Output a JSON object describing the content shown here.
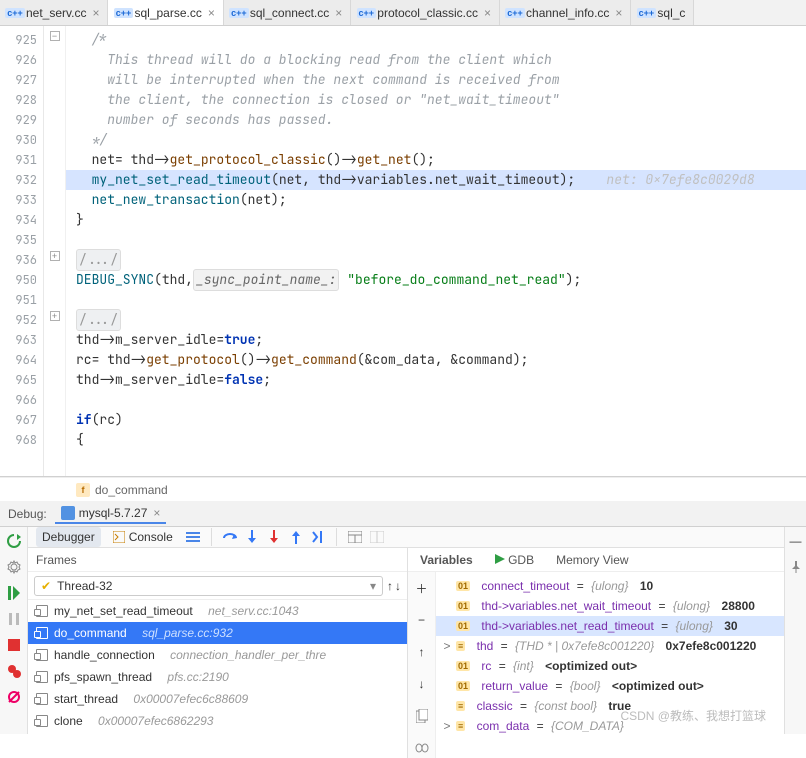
{
  "tabs": [
    {
      "label": "net_serv.cc",
      "icon": "c++",
      "active": false
    },
    {
      "label": "sql_parse.cc",
      "icon": "c++",
      "active": true
    },
    {
      "label": "sql_connect.cc",
      "icon": "c++",
      "active": false
    },
    {
      "label": "protocol_classic.cc",
      "icon": "c++",
      "active": false
    },
    {
      "label": "channel_info.cc",
      "icon": "c++",
      "active": false
    },
    {
      "label": "sql_c",
      "icon": "c++",
      "active": false
    }
  ],
  "gutter": [
    "925",
    "926",
    "927",
    "928",
    "929",
    "930",
    "931",
    "932",
    "933",
    "934",
    "935",
    "936",
    "950",
    "951",
    "952",
    "963",
    "964",
    "965",
    "966",
    "967",
    "968"
  ],
  "code": {
    "l925": "/*",
    "l926": "This thread will do a blocking read from the client which",
    "l927": "will be interrupted when the next command is received from",
    "l928": "the client, the connection is closed or \"net_wait_timeout\"",
    "l929": "number of seconds has passed.",
    "l930": "*/",
    "l931_pre": "net= thd->",
    "l931_m1": "get_protocol_classic",
    "l931_mid": "()->",
    "l931_m2": "get_net",
    "l931_post": "();",
    "l932_fn": "my_net_set_read_timeout",
    "l932_args": "(net, thd->variables.net_wait_timeout);",
    "l932_inlay": "net: 0x7efe8c0029d8",
    "l933_fn": "net_new_transaction",
    "l933_args": "(net);",
    "l934": "}",
    "l936": "/.../",
    "l950_fn": "DEBUG_SYNC",
    "l950_open": "(thd, ",
    "l950_param": "_sync_point_name_:",
    "l950_str": "\"before_do_command_net_read\"",
    "l950_close": ");",
    "l952": "/.../",
    "l963_pre": "thd->m_server_idle= ",
    "l963_kw": "true",
    "l963_post": ";",
    "l964_pre": "rc= thd->",
    "l964_m1": "get_protocol",
    "l964_mid": "()->",
    "l964_m2": "get_command",
    "l964_post": "(&com_data, &command);",
    "l965_pre": "thd->m_server_idle= ",
    "l965_kw": "false",
    "l965_post": ";",
    "l967_kw": "if",
    "l967_rest": " (rc)",
    "l968": "{"
  },
  "breadcrumb": {
    "icon": "f",
    "name": "do_command"
  },
  "debug": {
    "label": "Debug:",
    "config": "mysql-5.7.27",
    "tabs": {
      "debugger": "Debugger",
      "console": "Console"
    },
    "frames_title": "Frames",
    "thread": "Thread-32",
    "frames": [
      {
        "name": "my_net_set_read_timeout",
        "loc": "net_serv.cc:1043"
      },
      {
        "name": "do_command",
        "loc": "sql_parse.cc:932",
        "sel": true
      },
      {
        "name": "handle_connection",
        "loc": "connection_handler_per_thre"
      },
      {
        "name": "pfs_spawn_thread",
        "loc": "pfs.cc:2190"
      },
      {
        "name": "start_thread",
        "loc": "0x00007efec6c88609"
      },
      {
        "name": "clone",
        "loc": "0x00007efec6862293"
      }
    ],
    "vars_tabs": {
      "variables": "Variables",
      "gdb": "GDB",
      "memory": "Memory View"
    },
    "vars": [
      {
        "exp": "",
        "tag": "01",
        "name": "connect_timeout",
        "type": "{ulong}",
        "val": "10"
      },
      {
        "exp": "",
        "tag": "01",
        "name": "thd->variables.net_wait_timeout",
        "type": "{ulong}",
        "val": "28800"
      },
      {
        "exp": "",
        "tag": "01",
        "name": "thd->variables.net_read_timeout",
        "type": "{ulong}",
        "val": "30",
        "hl": true
      },
      {
        "exp": ">",
        "tag": "≡",
        "name": "thd",
        "type": "{THD * | 0x7efe8c001220}",
        "val": "0x7efe8c001220"
      },
      {
        "exp": "",
        "tag": "01",
        "name": "rc",
        "type": "{int}",
        "val": "<optimized out>"
      },
      {
        "exp": "",
        "tag": "01",
        "name": "return_value",
        "type": "{bool}",
        "val": "<optimized out>"
      },
      {
        "exp": "",
        "tag": "≡",
        "name": "classic",
        "type": "{const bool}",
        "val": "true"
      },
      {
        "exp": ">",
        "tag": "≡",
        "name": "com_data",
        "type": "{COM_DATA}",
        "val": ""
      }
    ]
  },
  "watermark": "CSDN @教练、我想打篮球"
}
